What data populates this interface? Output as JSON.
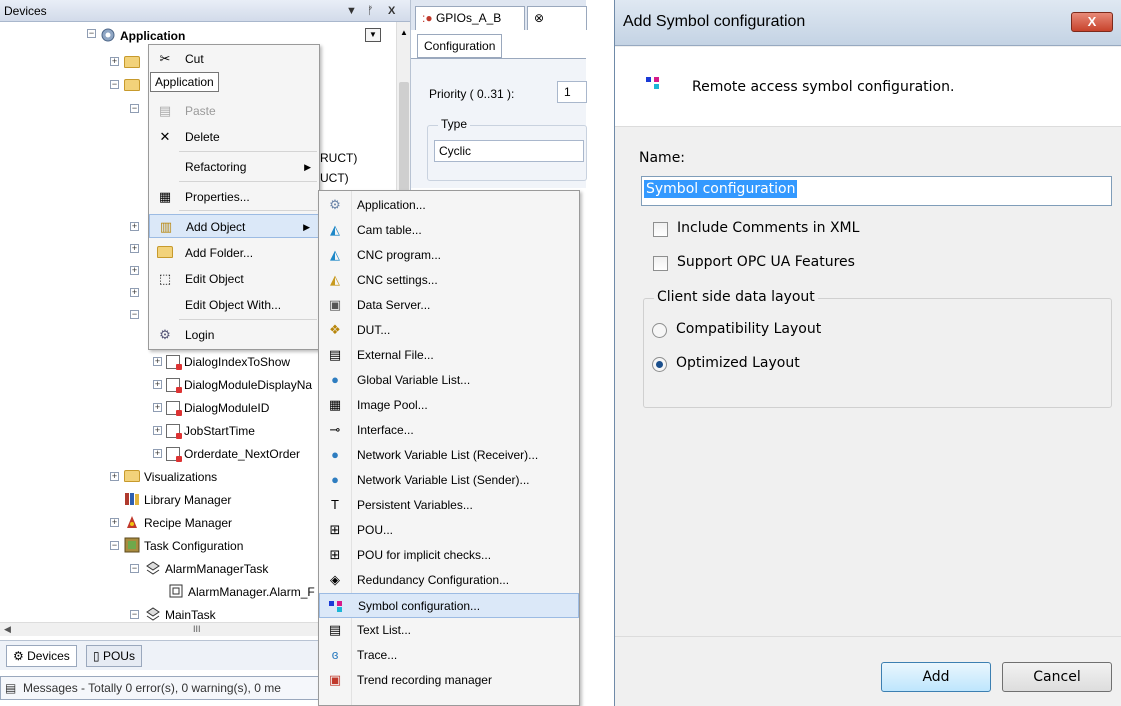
{
  "devices_panel": {
    "title": "Devices",
    "pin_glyph": "⬇",
    "close_glyph": "X",
    "tree": {
      "application": "Application",
      "dialog_index": "DialogIndexToShow",
      "dialog_module_display": "DialogModuleDisplayNa",
      "dialog_module_id": "DialogModuleID",
      "job_start_time": "JobStartTime",
      "orderdate": "Orderdate_NextOrder",
      "visualizations": "Visualizations",
      "library_manager": "Library Manager",
      "recipe_manager": "Recipe Manager",
      "task_configuration": "Task Configuration",
      "alarm_manager_task": "AlarmManagerTask",
      "alarm_manager_alarm": "AlarmManager.Alarm_F",
      "main_task": "MainTask",
      "partial_struct_1": "RUCT)",
      "partial_struct_2": "UCT)"
    },
    "hscroll_label": "III",
    "tabs": {
      "devices": "Devices",
      "pous": "POUs"
    },
    "messages": "Messages - Totally 0 error(s), 0 warning(s), 0 me"
  },
  "editor": {
    "tabs": {
      "gpios": "GPIOs_A_B"
    },
    "config_tab": "Configuration",
    "priority_label": "Priority ( 0..31 ):",
    "priority_value": "1",
    "type_label": "Type",
    "type_value": "Cyclic"
  },
  "context_menu": {
    "tooltip": "Application",
    "items": {
      "cut": "Cut",
      "paste": "Paste",
      "delete": "Delete",
      "refactoring": "Refactoring",
      "properties": "Properties...",
      "add_object": "Add Object",
      "add_folder": "Add Folder...",
      "edit_object": "Edit Object",
      "edit_object_with": "Edit Object With...",
      "login": "Login"
    }
  },
  "submenu": {
    "items": {
      "application": "Application...",
      "cam_table": "Cam table...",
      "cnc_program": "CNC program...",
      "cnc_settings": "CNC settings...",
      "data_server": "Data Server...",
      "dut": "DUT...",
      "external_file": "External File...",
      "global_var_list": "Global Variable List...",
      "image_pool": "Image Pool...",
      "interface": "Interface...",
      "nvl_receiver": "Network Variable List (Receiver)...",
      "nvl_sender": "Network Variable List (Sender)...",
      "persistent_vars": "Persistent Variables...",
      "pou": "POU...",
      "pou_implicit": "POU for implicit checks...",
      "redundancy": "Redundancy Configuration...",
      "symbol_config": "Symbol configuration...",
      "text_list": "Text List...",
      "trace": "Trace...",
      "trend": "Trend recording manager"
    }
  },
  "dialog": {
    "title": "Add Symbol configuration",
    "close": "X",
    "header_text": "Remote access symbol configuration.",
    "name_label": "Name:",
    "name_value": "Symbol configuration",
    "include_comments": "Include Comments in XML",
    "support_opc": "Support OPC UA Features",
    "layout_legend": "Client side data layout",
    "compat_layout": "Compatibility Layout",
    "optimized_layout": "Optimized Layout",
    "selected_layout": "Optimized Layout",
    "add": "Add",
    "cancel": "Cancel"
  }
}
